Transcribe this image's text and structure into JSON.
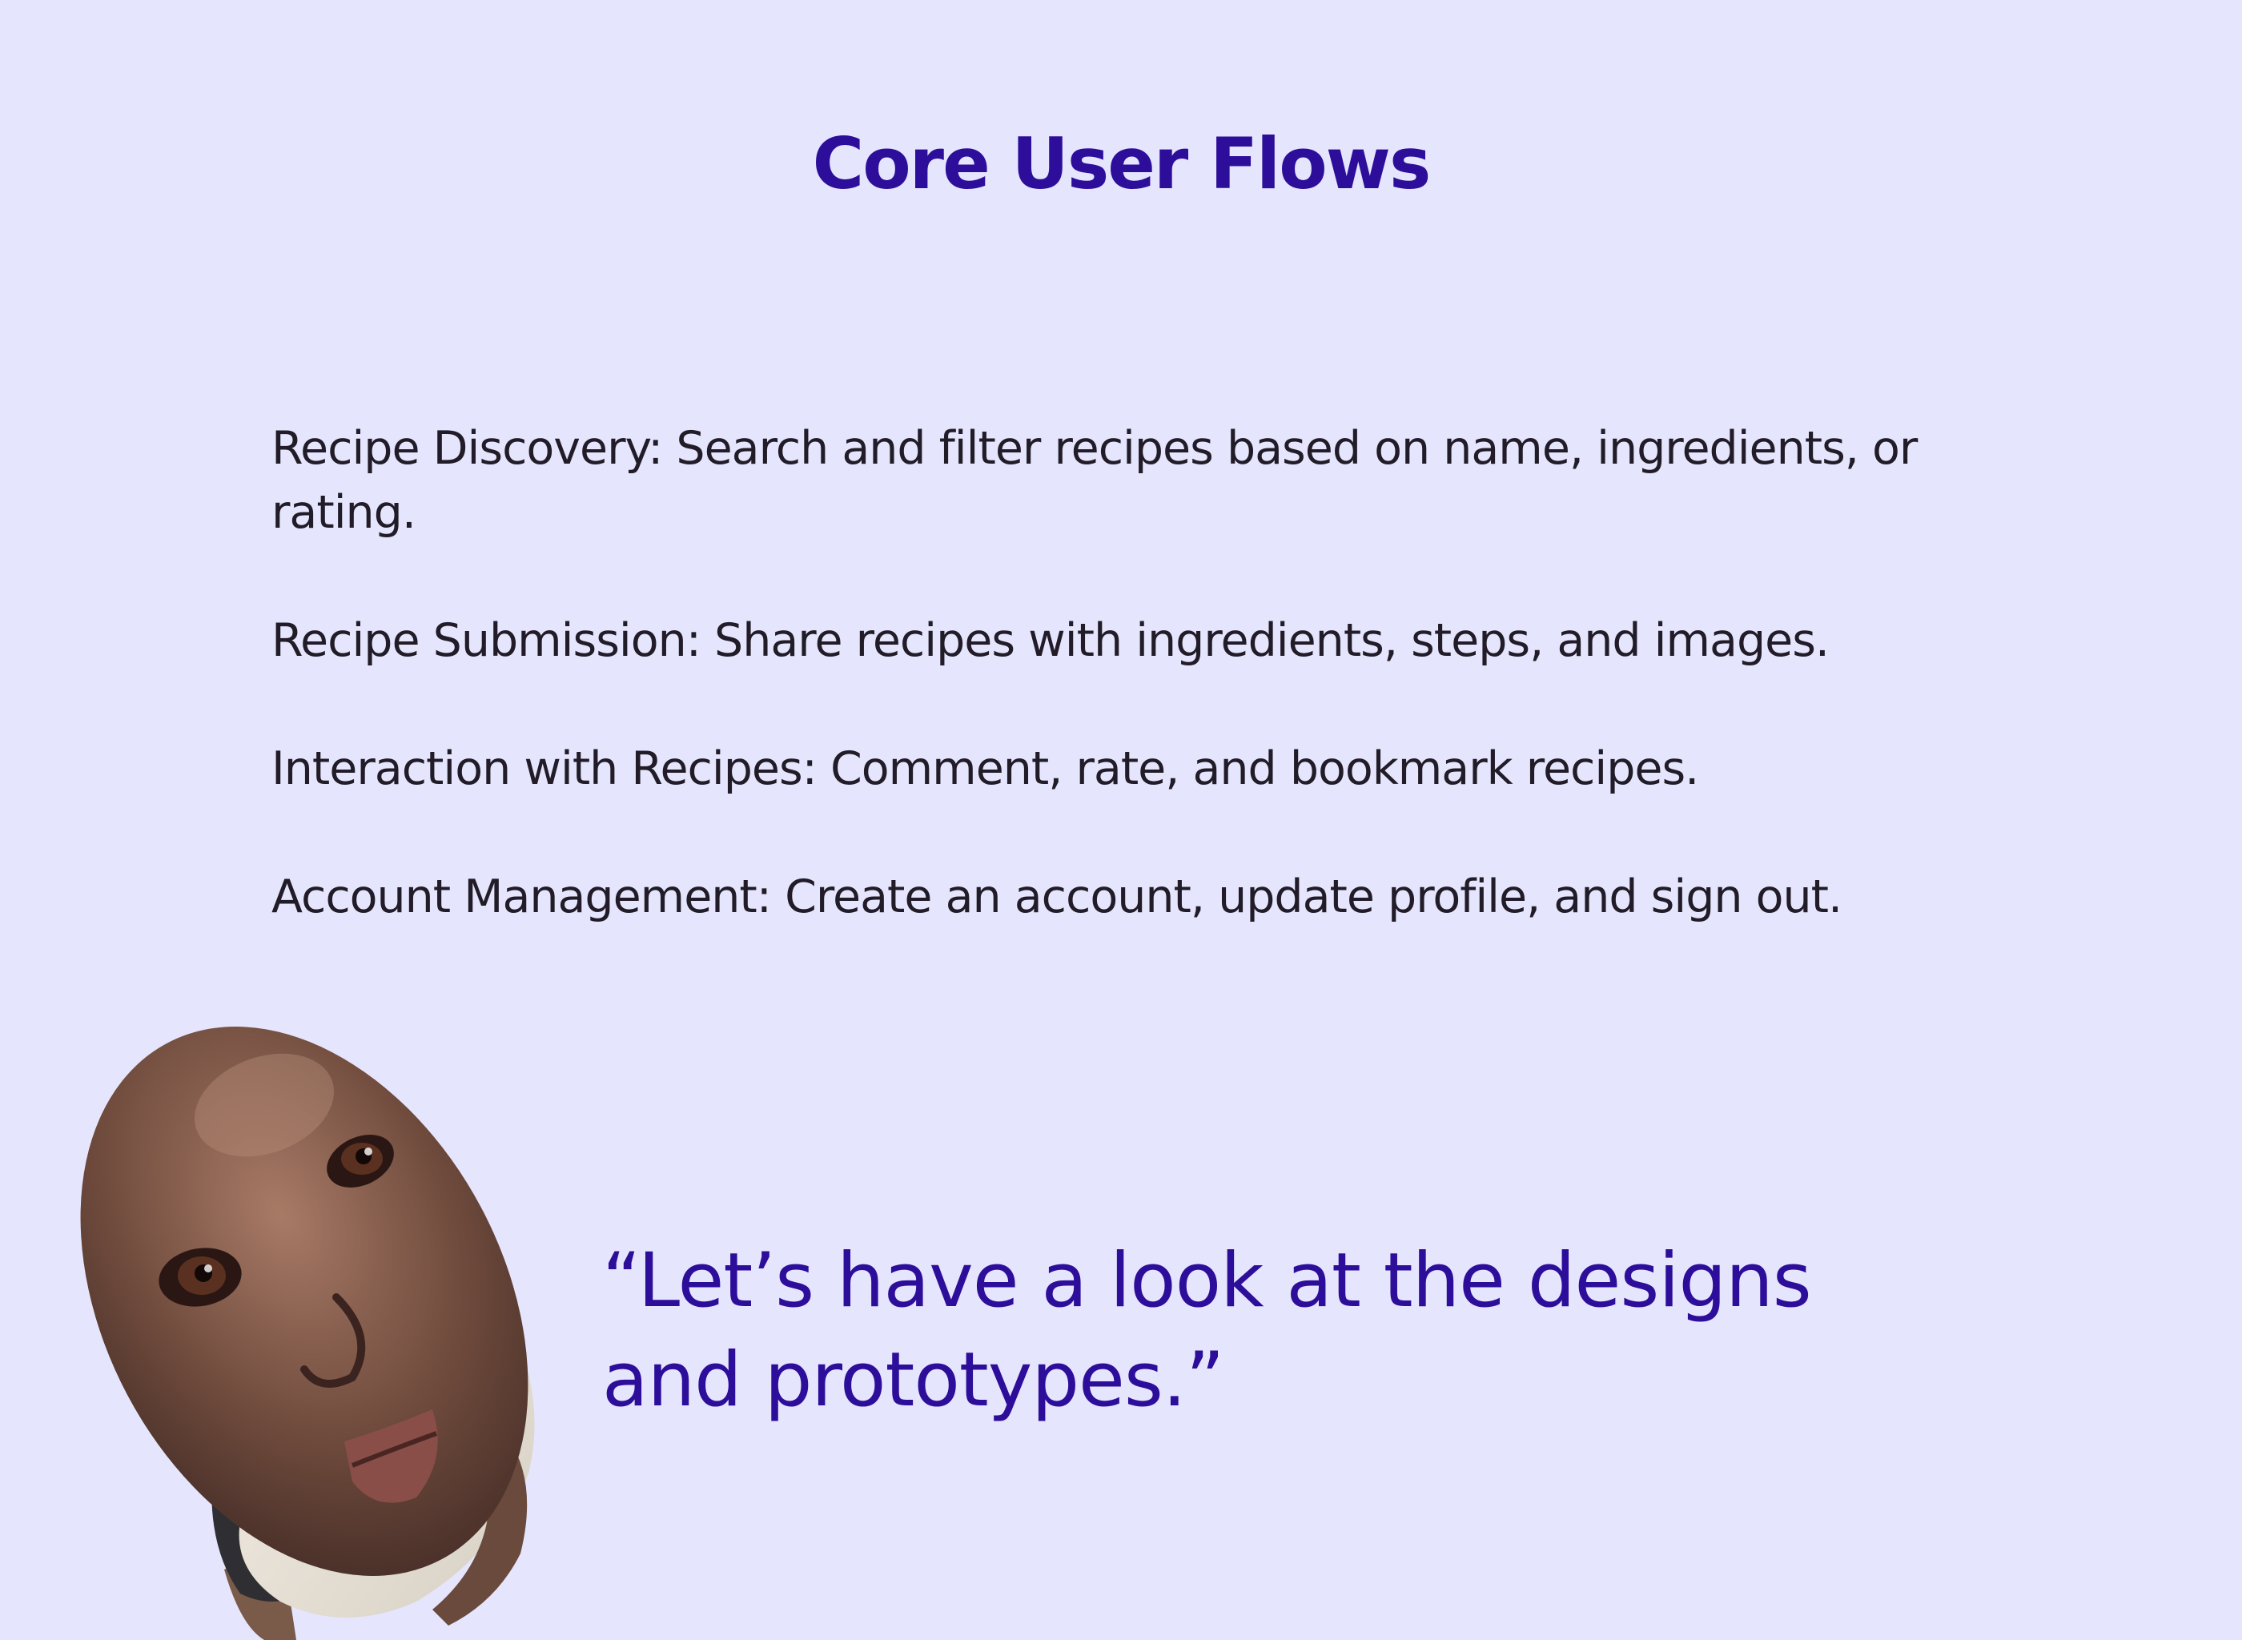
{
  "slide": {
    "title": "Core User Flows",
    "flows": [
      {
        "text": "Recipe Discovery: Search and filter recipes based on name, ingredients, or rating."
      },
      {
        "text": "Recipe Submission: Share recipes with ingredients, steps, and images."
      },
      {
        "text": "Interaction with Recipes: Comment, rate, and bookmark recipes."
      },
      {
        "text": "Account Management: Create an account, update profile, and sign out."
      }
    ],
    "quote": "“Let’s have a look at the designs and prototypes.”"
  },
  "colors": {
    "background": "#e5e6fd",
    "title": "#2d0e9a",
    "body_text": "#221c28",
    "quote": "#2d0e9a"
  }
}
